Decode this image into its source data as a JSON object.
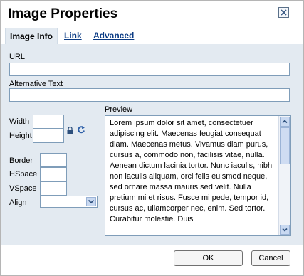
{
  "dialog": {
    "title": "Image Properties",
    "close_icon": "close-icon"
  },
  "tabs": [
    {
      "label": "Image Info",
      "active": true
    },
    {
      "label": "Link",
      "active": false
    },
    {
      "label": "Advanced",
      "active": false
    }
  ],
  "fields": {
    "url_label": "URL",
    "url_value": "",
    "alt_label": "Alternative Text",
    "alt_value": "",
    "width_label": "Width",
    "width_value": "",
    "height_label": "Height",
    "height_value": "",
    "border_label": "Border",
    "border_value": "",
    "hspace_label": "HSpace",
    "hspace_value": "",
    "vspace_label": "VSpace",
    "vspace_value": "",
    "align_label": "Align",
    "align_value": ""
  },
  "icons": {
    "lock": "lock-icon",
    "reset": "reset-size-icon"
  },
  "preview": {
    "label": "Preview",
    "text": "Lorem ipsum dolor sit amet, consectetuer adipiscing elit. Maecenas feugiat consequat diam. Maecenas metus. Vivamus diam purus, cursus a, commodo non, facilisis vitae, nulla. Aenean dictum lacinia tortor. Nunc iaculis, nibh non iaculis aliquam, orci felis euismod neque, sed ornare massa mauris sed velit. Nulla pretium mi et risus. Fusce mi pede, tempor id, cursus ac, ullamcorper nec, enim. Sed tortor. Curabitur molestie. Duis"
  },
  "buttons": {
    "ok": "OK",
    "cancel": "Cancel"
  },
  "colors": {
    "panel": "#e3eaf1",
    "link": "#0b3b84",
    "border": "#7f9db9"
  }
}
